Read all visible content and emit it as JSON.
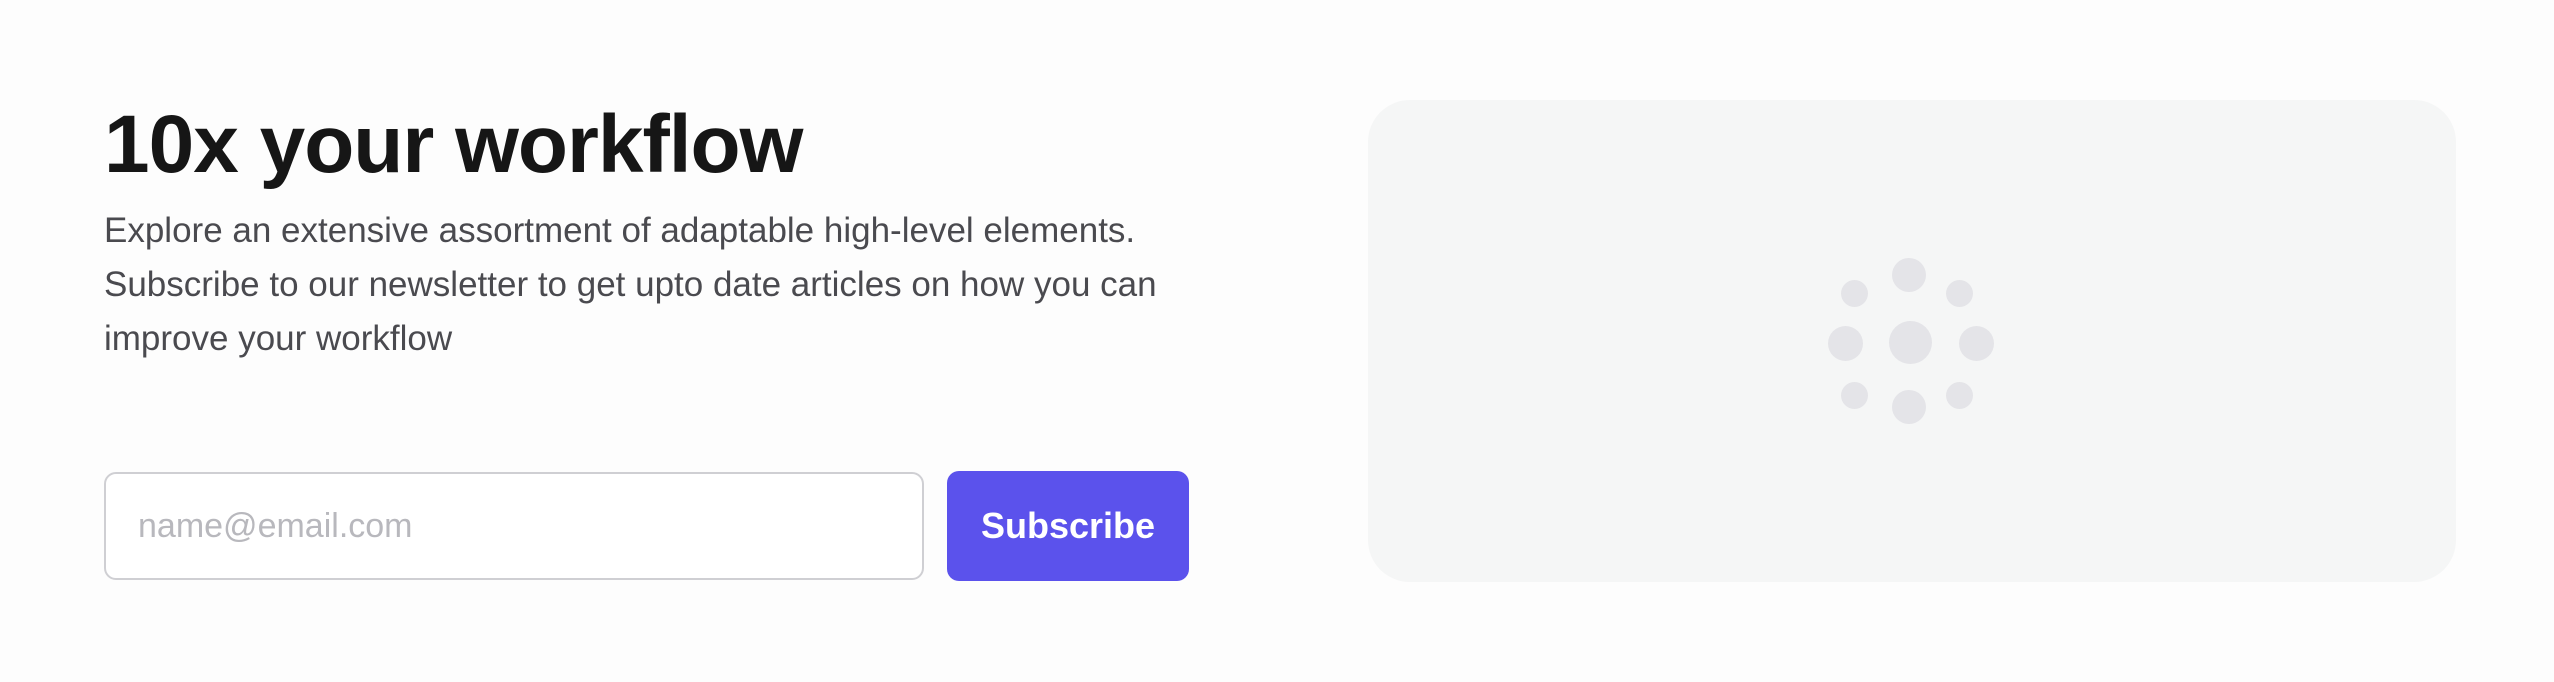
{
  "hero": {
    "title": "10x your workflow",
    "description": "Explore an extensive assortment of adaptable high-level elements. Subscribe to our newsletter to get upto date articles on how you can improve your workflow"
  },
  "form": {
    "email_placeholder": "name@email.com",
    "email_value": "",
    "subscribe_label": "Subscribe"
  },
  "media": {
    "state": "loading",
    "loader_icon": "loading-spinner-icon"
  },
  "colors": {
    "accent": "#5b52ec",
    "panel": "#f5f6f6",
    "loader_dots": "#e4e4e8"
  }
}
